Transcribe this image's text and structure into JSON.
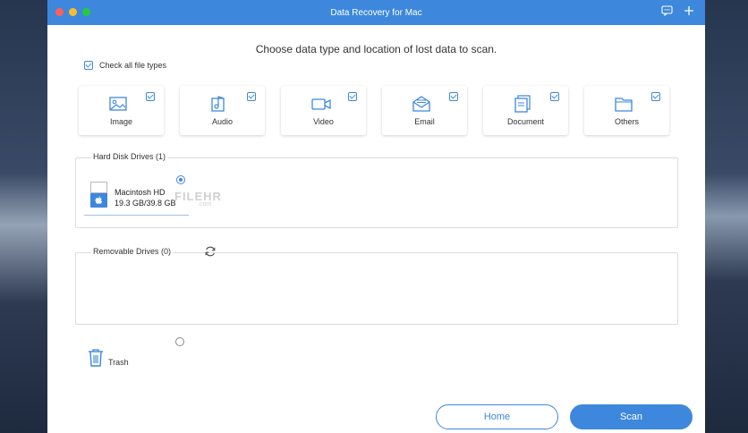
{
  "window": {
    "title": "Data Recovery for Mac"
  },
  "prompt": "Choose data type and location of lost data to scan.",
  "check_all": {
    "label": "Check all file types",
    "checked": true
  },
  "file_types": [
    {
      "label": "Image",
      "icon": "image-icon",
      "checked": true
    },
    {
      "label": "Audio",
      "icon": "audio-icon",
      "checked": true
    },
    {
      "label": "Video",
      "icon": "video-icon",
      "checked": true
    },
    {
      "label": "Email",
      "icon": "email-icon",
      "checked": true
    },
    {
      "label": "Document",
      "icon": "document-icon",
      "checked": true
    },
    {
      "label": "Others",
      "icon": "folder-icon",
      "checked": true
    }
  ],
  "hard_disk": {
    "label": "Hard Disk Drives (1)",
    "drives": [
      {
        "name": "Macintosh HD",
        "size": "19.3 GB/39.8 GB",
        "selected": true
      }
    ]
  },
  "removable": {
    "label": "Removable Drives (0)"
  },
  "trash": {
    "label": "Trash",
    "selected": false
  },
  "watermark": {
    "main": "FILEHR",
    "sub": ".com"
  },
  "buttons": {
    "home": "Home",
    "scan": "Scan"
  },
  "colors": {
    "accent": "#3d88dc",
    "titlebar": "#3d88dc"
  }
}
